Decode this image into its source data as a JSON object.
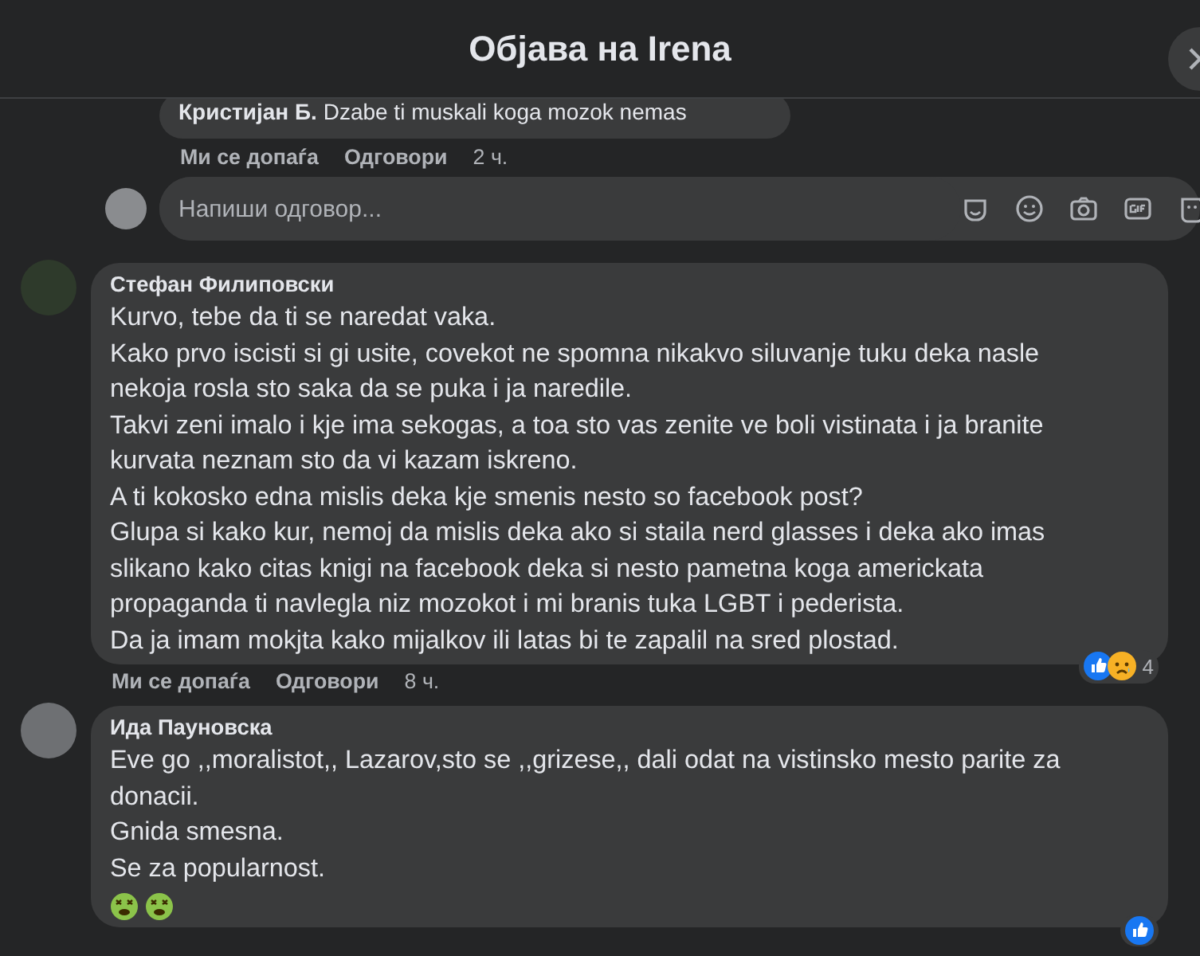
{
  "header": {
    "title": "Објава на Irena"
  },
  "reply_above": {
    "author": "Кристијан Б.",
    "text": "Dzabe ti muskali koga mozok nemas",
    "actions": [
      "Ми се допаѓа",
      "Одговори"
    ],
    "time": "2 ч."
  },
  "reply_box": {
    "placeholder": "Напиши одговор...",
    "tools": [
      {
        "kind": "sticker"
      },
      {
        "kind": "emoji"
      },
      {
        "kind": "camera"
      },
      {
        "kind": "gif"
      },
      {
        "kind": "avatar-sticker"
      }
    ]
  },
  "comments": [
    {
      "author": "Стефан Филиповски",
      "lines": [
        "Kurvo, tebe da ti se naredat vaka.",
        "Kako prvo iscisti si gi usite, covekot ne spomna nikakvo siluvanje tuku deka nasle nekoja rosla sto saka da se puka i ja naredile.",
        "Takvi zeni imalo i kje ima sekogas, a toa sto vas zenite ve boli vistinata i ja branite kurvata neznam sto da vi kazam iskreno.",
        "A ti kokosko edna mislis deka kje smenis nesto so facebook post?",
        "Glupa si kako kur, nemoj da mislis deka ako si staila nerd glasses i deka ako imas slikano kako citas knigi na facebook deka si nesto pametna koga americkata propaganda ti navlegla niz mozokot i mi branis tuka LGBT i pederista.",
        "Da ja imam mokjta kako mijalkov ili latas bi te zapalil na sred plostad."
      ],
      "reactions": [
        {
          "kind": "like"
        },
        {
          "kind": "sad"
        }
      ],
      "reaction_count": "4",
      "actions": [
        "Ми се допаѓа",
        "Одговори"
      ],
      "time": "8 ч."
    },
    {
      "author": "Ида Пауновска",
      "lines": [
        "Eve go ,,moralistot,, Lazarov,sto se ,,grizese,, dali odat na vistinsko mesto parite za donacii.",
        "Gnida smesna.",
        "Se za popularnost."
      ],
      "emojis": [
        {
          "kind": "sick-face"
        },
        {
          "kind": "sick-face"
        }
      ],
      "reactions": [
        {
          "kind": "like"
        }
      ]
    }
  ]
}
